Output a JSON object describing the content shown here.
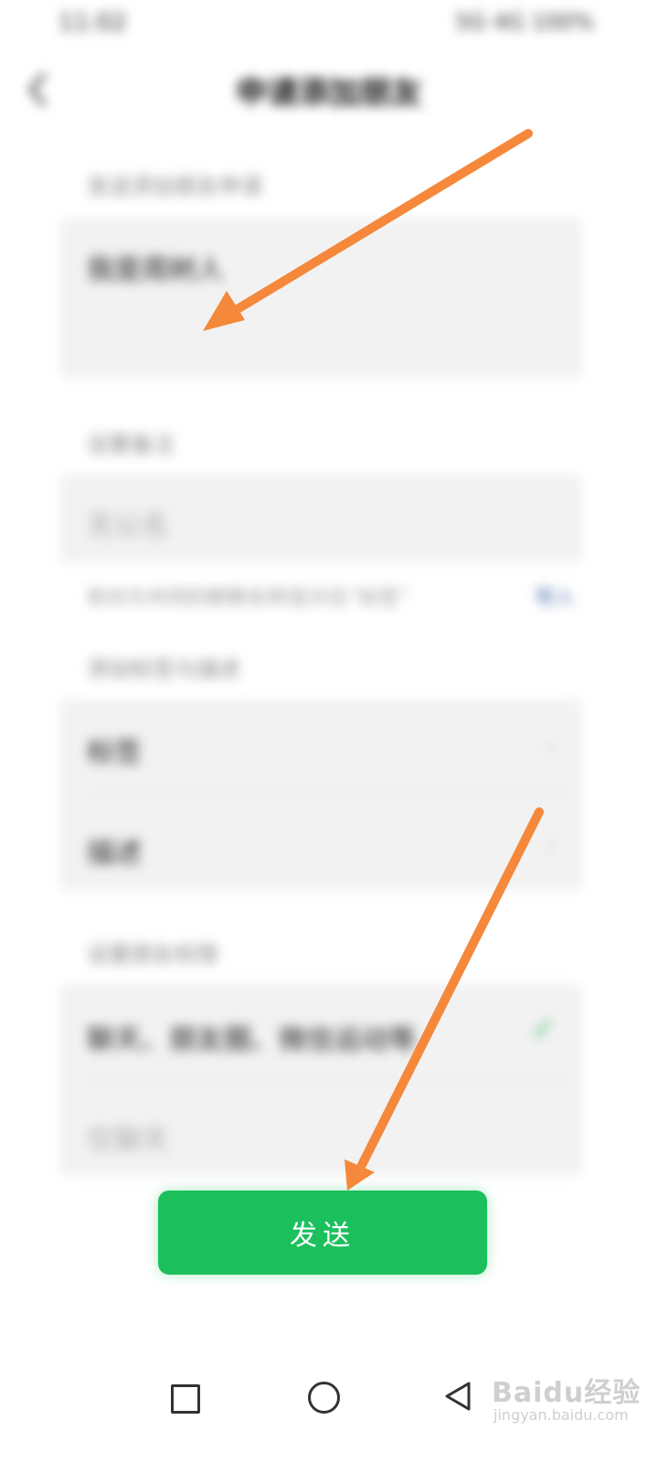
{
  "status_bar": {
    "time": "11:02",
    "indicators": "5G 4G 100%"
  },
  "header": {
    "title": "申请添加朋友",
    "back_icon": "chevron-left-icon"
  },
  "greeting": {
    "label": "发送添加朋友申请",
    "value": "我是周树人"
  },
  "remark": {
    "label": "设置备注",
    "placeholder": "无公名"
  },
  "hint": {
    "text": "和对方共同的群聊名称显示在“标签”",
    "link": "导入"
  },
  "tags": {
    "label": "添加标签与描述",
    "items": [
      {
        "label": "标签"
      },
      {
        "label": "描述"
      }
    ]
  },
  "permissions": {
    "label": "设置朋友权限",
    "options": [
      {
        "label": "聊天、朋友圈、微信运动等",
        "selected": true
      },
      {
        "label": "仅聊天",
        "selected": false
      }
    ]
  },
  "actions": {
    "send_label": "发送"
  },
  "watermark": {
    "logo": "Baidu经验",
    "url": "jingyan.baidu.com"
  },
  "colors": {
    "accent": "#1bc05c",
    "arrow": "#f5883a"
  }
}
